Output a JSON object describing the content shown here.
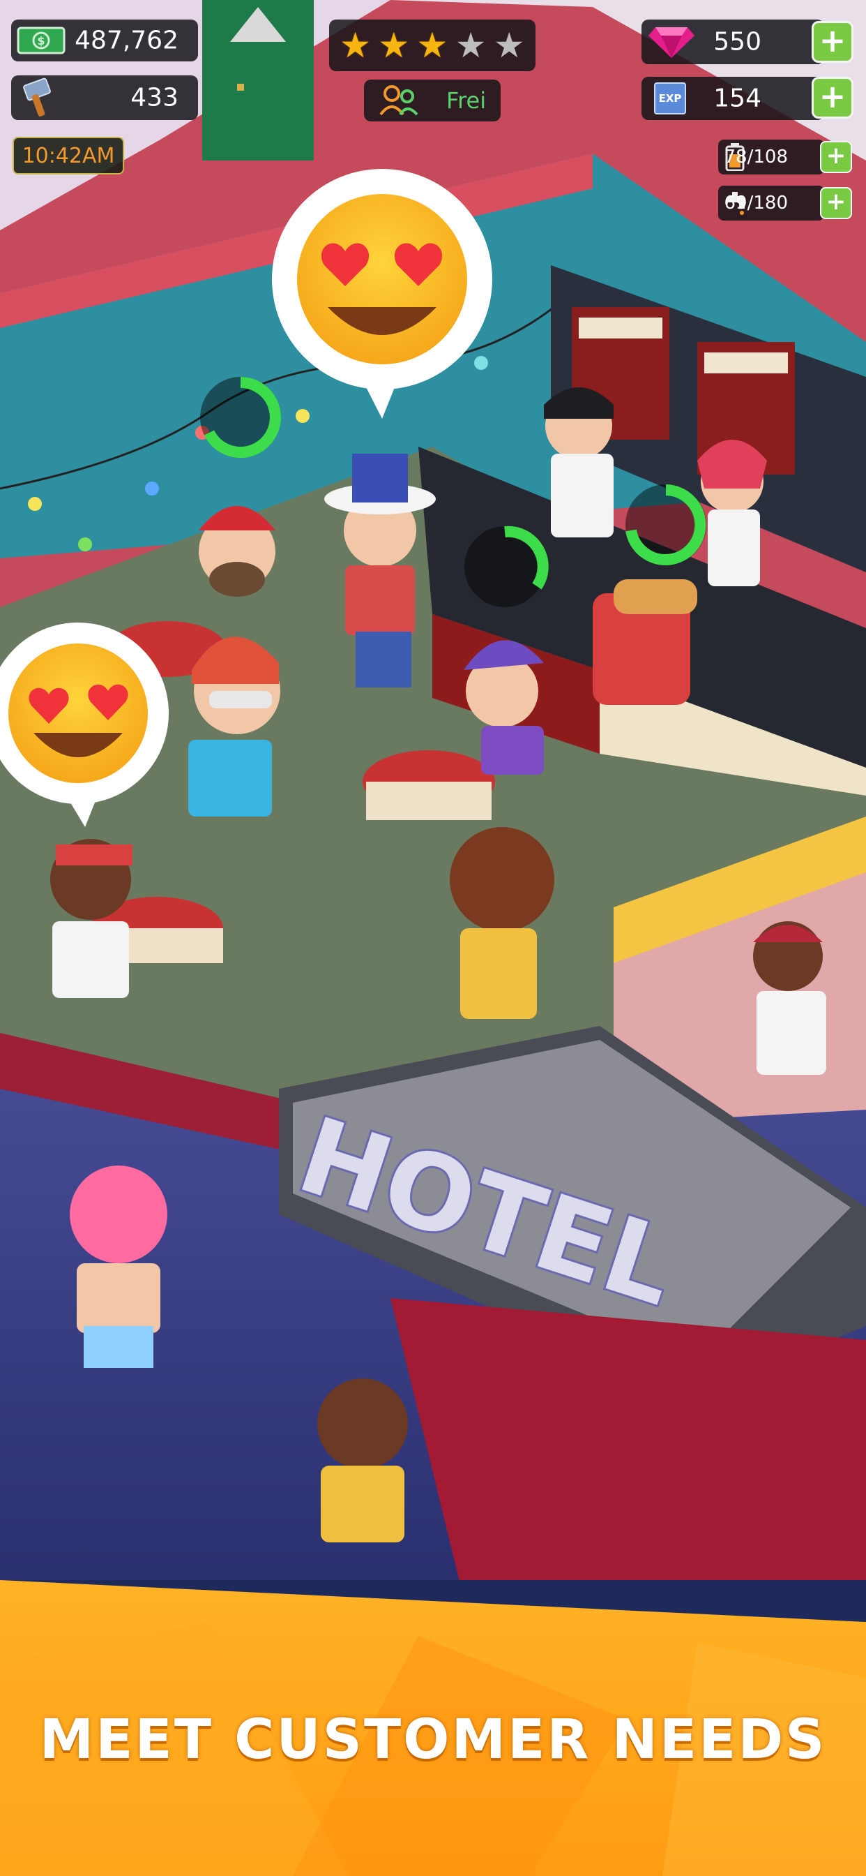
{
  "hud": {
    "cash": "487,762",
    "hammers": "433",
    "time": "10:42AM",
    "stars_filled": 3,
    "stars_total": 5,
    "staff_status": "Frei",
    "gems": "550",
    "exp": "154",
    "exp_icon_text": "EXP",
    "supplies": "78/108",
    "water": "69/180",
    "plus_label": "+"
  },
  "scene": {
    "sign_text": "HOTEL",
    "bubble_icon": "heart-eyes-emoji",
    "progress_icon": "progress-ring-icon"
  },
  "banner": {
    "headline": "MEET CUSTOMER NEEDS"
  },
  "colors": {
    "accent_green": "#7ac943",
    "status_green": "#58d36b",
    "time_orange": "#f29a2e",
    "banner_orange": "#ff9c12",
    "gem_pink": "#e61e8c",
    "star_gold": "#f7b512"
  }
}
